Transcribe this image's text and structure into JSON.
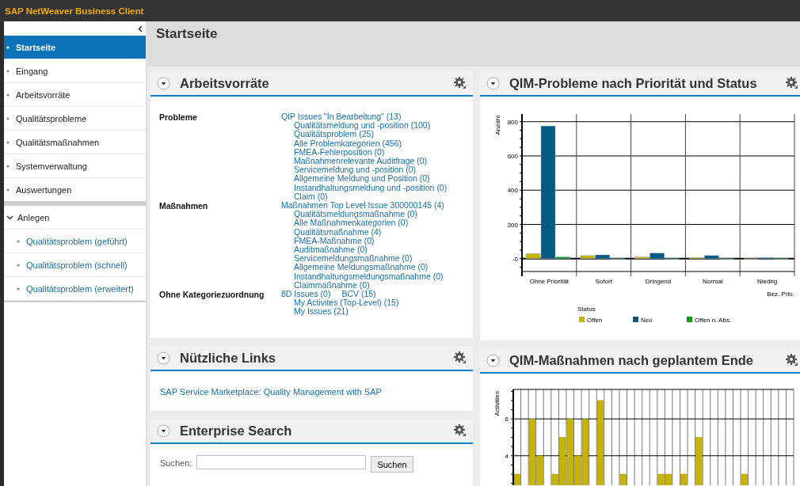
{
  "app": {
    "title": "SAP NetWeaver Business Client"
  },
  "sidebar": {
    "items": [
      {
        "kind": "item",
        "label": "Startseite",
        "selected": true
      },
      {
        "kind": "item",
        "label": "Eingang",
        "selected": false
      },
      {
        "kind": "item",
        "label": "Arbeitsvorräte",
        "selected": false
      },
      {
        "kind": "item",
        "label": "Qualitätsprobleme",
        "selected": false
      },
      {
        "kind": "item",
        "label": "Qualitätsmaßnahmen",
        "selected": false
      },
      {
        "kind": "item",
        "label": "Systemverwaltung",
        "selected": false
      },
      {
        "kind": "item",
        "label": "Auswertungen",
        "selected": false
      },
      {
        "kind": "group",
        "label": "Anlegen",
        "expanded": true,
        "children": [
          {
            "label": "Qualitätsproblem (geführt)",
            "selected": false
          },
          {
            "label": "Qualitätsproblem (schnell)",
            "selected": false
          },
          {
            "label": "Qualitätsproblem (erweitert)",
            "selected": false
          }
        ]
      }
    ]
  },
  "page": {
    "title": "Startseite"
  },
  "worklists": {
    "title": "Arbeitsvorräte",
    "groups": [
      {
        "label": "Probleme",
        "first": [
          "QIP Issues \"In Bearbeitung\" (13)"
        ],
        "items": [
          "Qualitätsmeldung und -position (100)",
          "Qualitätsproblem (25)",
          "Alle Problemkategorien (456)",
          "FMEA-Fehlerposition (0)",
          "Maßnahmenrelevante Auditfrage (0)",
          "Servicemeldung und -position (0)",
          "Allgemeine Meldung und Position (0)",
          "Instandhaltungsmeldung und -position (0)",
          "Claim (0)"
        ]
      },
      {
        "label": "Maßnahmen",
        "first": [
          "Maßnahmen Top Level Issue 300000145 (4)"
        ],
        "items": [
          "Qualitätsmeldungsmaßnahme (0)",
          "Alle Maßnahmenkategorien (0)",
          "Qualitätsmaßnahme (4)",
          "FMEA-Maßnahme (0)",
          "Auditmaßnahme (0)",
          "Servicemeldungsmaßnahme (0)",
          "Allgemeine Meldungsmaßnahme (0)",
          "Instandhaltungsmeldungsmaßnahme (0)",
          "Claimmaßnahme (0)"
        ]
      },
      {
        "label": "Ohne Kategoriezuordnung",
        "first": [
          "8D Issues (0)",
          "BCV (15)"
        ],
        "items": [
          "My Activites (Top-Level) (15)",
          "My Issues (21)"
        ]
      }
    ]
  },
  "links": {
    "title": "Nützliche Links",
    "items": [
      "SAP Service Marketplace: Quality Management with SAP"
    ]
  },
  "search": {
    "title": "Enterprise Search",
    "label": "Suchen:",
    "button": "Suchen"
  },
  "problems_chart": {
    "title": "QIM-Probleme nach Priorität und Status",
    "chart_data": {
      "type": "bar",
      "ylabel": "Anzahl",
      "xlabel": "Bez. Prio.",
      "legend_title": "Status",
      "categories": [
        "Ohne Priorität",
        "Sofort",
        "Dringend",
        "Normal",
        "Niedrig"
      ],
      "series": [
        {
          "name": "Offen",
          "color": "#c8b400",
          "values": [
            30,
            18,
            10,
            5,
            0
          ]
        },
        {
          "name": "Neu",
          "color": "#005a82",
          "values": [
            775,
            22,
            32,
            18,
            5
          ]
        },
        {
          "name": "Offen n. Abs.",
          "color": "#00a000",
          "values": [
            10,
            0,
            0,
            0,
            0
          ]
        }
      ],
      "ylim": [
        -75,
        845
      ],
      "yticks": [
        {
          "value": 0,
          "label": "-0"
        },
        200,
        400,
        600,
        800
      ],
      "grid": true,
      "legend": true
    }
  },
  "actions_chart": {
    "title": "QIM-Maßnahmen nach geplantem Ende",
    "chart_data": {
      "type": "bar",
      "ylabel": "Activities",
      "series": [
        {
          "color": "#c8b400",
          "values": [
            3,
            null,
            6,
            4,
            null,
            3,
            5,
            6,
            4,
            6,
            null,
            7,
            null,
            null,
            3,
            null,
            null,
            null,
            null,
            3,
            3,
            null,
            3,
            null,
            5,
            null,
            null,
            null,
            null,
            null,
            3,
            null,
            null,
            null,
            null,
            null,
            null
          ]
        }
      ],
      "ylim": [
        2.4,
        7.6
      ],
      "yticks": [
        4,
        6
      ],
      "grid": true
    }
  }
}
